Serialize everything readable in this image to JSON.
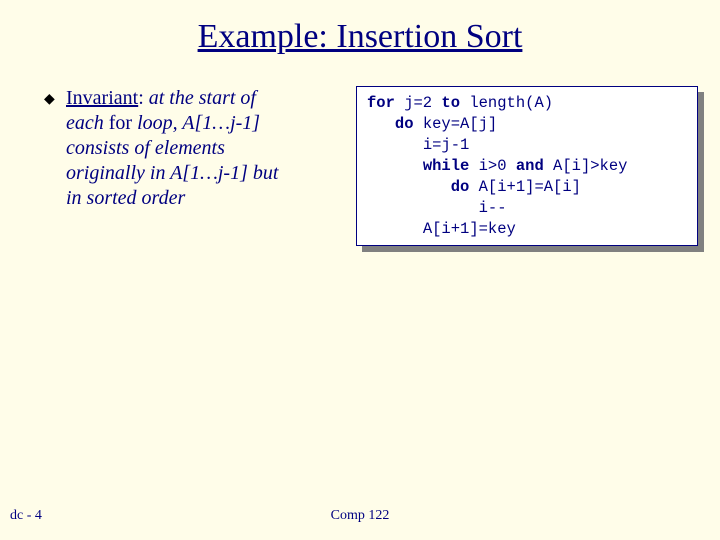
{
  "title": "Example: Insertion Sort",
  "bullet": {
    "invariant_label": "Invariant",
    "sep": ": ",
    "line1a": "at the start of",
    "line2a": "each ",
    "line2b": "for",
    "line2c": " loop, A[1…j-1]",
    "line3": "consists of elements",
    "line4": "originally in A[1…j-1] but",
    "line5": "in sorted order"
  },
  "code": {
    "l1a": "for",
    "l1b": " j=2 ",
    "l1c": "to",
    "l1d": " length(A)",
    "l2a": "do",
    "l2b": " key=A[j]",
    "l3": "i=j-1",
    "l4a": "while",
    "l4b": " i>0 ",
    "l4c": "and",
    "l4d": " A[i]>key",
    "l5a": "do",
    "l5b": " A[i+1]=A[i]",
    "l6": "i--",
    "l7": "A[i+1]=key"
  },
  "footer": {
    "left": "dc - 4",
    "center": "Comp 122"
  }
}
